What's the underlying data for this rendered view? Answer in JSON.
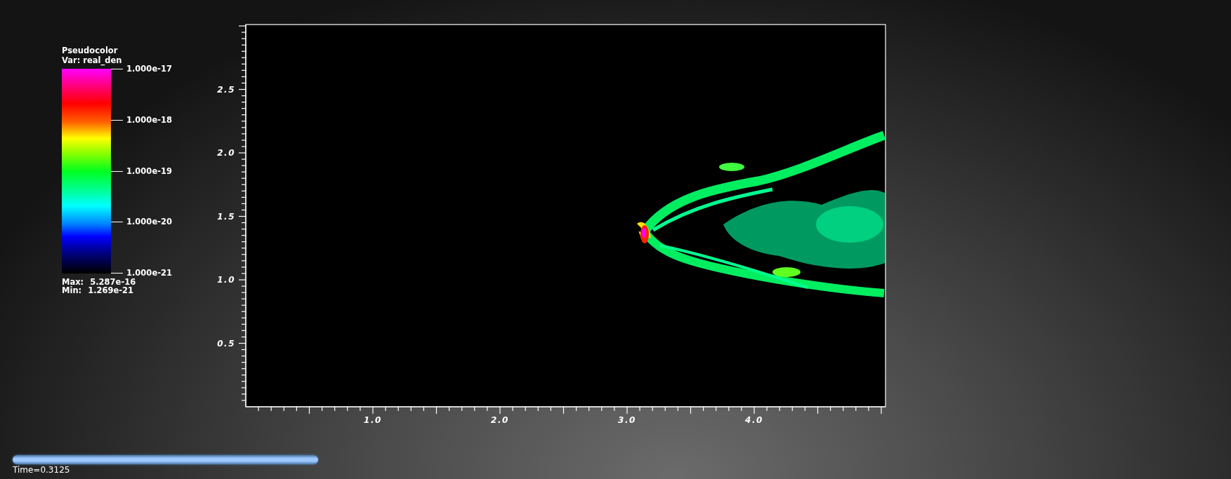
{
  "legend": {
    "title": "Pseudocolor",
    "variable": "Var: real_den",
    "ticks": [
      "1.000e-17",
      "1.000e-18",
      "1.000e-19",
      "1.000e-20",
      "1.000e-21"
    ],
    "max_label": "Max:",
    "max_value": "5.287e-16",
    "min_label": "Min:",
    "min_value": "1.269e-21"
  },
  "plot": {
    "x_ticks": [
      "1.0",
      "2.0",
      "3.0",
      "4.0"
    ],
    "y_ticks": [
      "2.5",
      "2.0",
      "1.5",
      "1.0",
      "0.5"
    ]
  },
  "time_slider": {
    "level": 1,
    "label": "Time=0.3125"
  }
}
